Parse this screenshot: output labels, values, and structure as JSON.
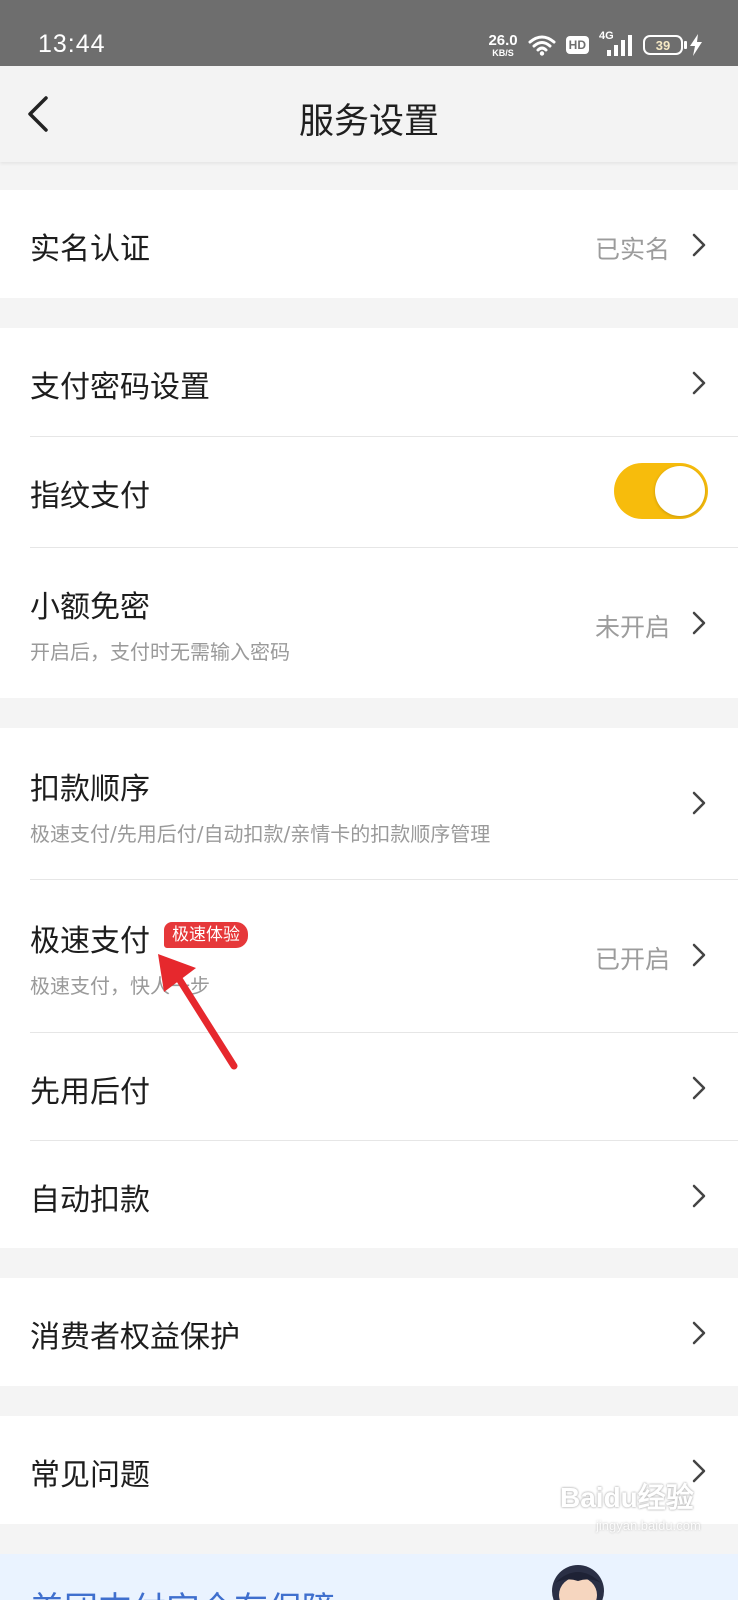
{
  "status_bar": {
    "time": "13:44",
    "net_speed_value": "26.0",
    "net_speed_unit": "KB/S",
    "hd": "HD",
    "net_type": "4G",
    "battery": "39"
  },
  "header": {
    "title": "服务设置",
    "back_icon": "chevron-left-icon"
  },
  "groups": {
    "verify": {
      "title": "实名认证",
      "value": "已实名"
    },
    "password": {
      "items": [
        {
          "title": "支付密码设置"
        },
        {
          "title": "指纹支付",
          "toggle_on": true
        },
        {
          "title": "小额免密",
          "subtitle": "开启后，支付时无需输入密码",
          "value": "未开启"
        }
      ]
    },
    "payment": {
      "items": [
        {
          "title": "扣款顺序",
          "subtitle": "极速支付/先用后付/自动扣款/亲情卡的扣款顺序管理"
        },
        {
          "title": "极速支付",
          "badge": "极速体验",
          "subtitle": "极速支付，快人一步",
          "value": "已开启"
        },
        {
          "title": "先用后付"
        },
        {
          "title": "自动扣款"
        }
      ]
    },
    "consumer": {
      "title": "消费者权益保护"
    },
    "faq": {
      "title": "常见问题"
    }
  },
  "banner": {
    "text": "美团支付安全有保障"
  },
  "watermark": {
    "text": "Baidu经验",
    "url": "jingyan.baidu.com"
  },
  "colors": {
    "toggle_on": "#f7bc0c",
    "badge": "#e6383a",
    "annotation_arrow": "#e6282d",
    "banner_text": "#3f6fce"
  }
}
